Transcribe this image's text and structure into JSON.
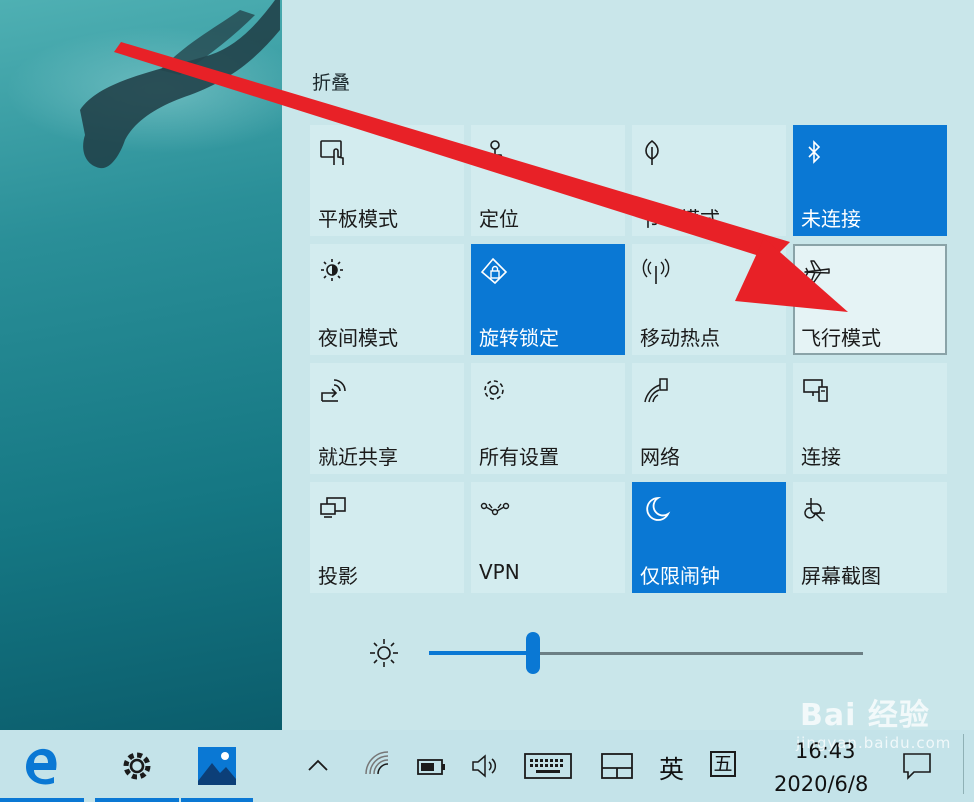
{
  "action_center": {
    "collapse_label": "折叠",
    "tiles": [
      {
        "label": "平板模式",
        "icon": "tablet-mode-icon",
        "state": "off"
      },
      {
        "label": "定位",
        "icon": "location-icon",
        "state": "off"
      },
      {
        "label": "节电模式",
        "icon": "battery-saver-icon",
        "state": "off"
      },
      {
        "label": "未连接",
        "icon": "bluetooth-icon",
        "state": "on"
      },
      {
        "label": "夜间模式",
        "icon": "night-light-icon",
        "state": "off"
      },
      {
        "label": "旋转锁定",
        "icon": "rotation-lock-icon",
        "state": "on"
      },
      {
        "label": "移动热点",
        "icon": "mobile-hotspot-icon",
        "state": "off"
      },
      {
        "label": "飞行模式",
        "icon": "airplane-icon",
        "state": "focused"
      },
      {
        "label": "就近共享",
        "icon": "nearby-share-icon",
        "state": "off"
      },
      {
        "label": "所有设置",
        "icon": "settings-gear-icon",
        "state": "off"
      },
      {
        "label": "网络",
        "icon": "network-icon",
        "state": "off"
      },
      {
        "label": "连接",
        "icon": "connect-icon",
        "state": "off"
      },
      {
        "label": "投影",
        "icon": "project-icon",
        "state": "off"
      },
      {
        "label": "VPN",
        "icon": "vpn-icon",
        "state": "off"
      },
      {
        "label": "仅限闹钟",
        "icon": "focus-assist-moon-icon",
        "state": "on"
      },
      {
        "label": "屏幕截图",
        "icon": "screen-snip-icon",
        "state": "off"
      }
    ],
    "brightness": {
      "icon": "brightness-icon",
      "level_fraction": 0.24
    }
  },
  "taskbar": {
    "apps": [
      {
        "name": "edge-browser-icon",
        "active": true
      },
      {
        "name": "settings-gear-icon",
        "active": true
      },
      {
        "name": "photos-app-icon",
        "active": true
      }
    ],
    "tray": {
      "show_hidden_icon": "chevron-up-icon",
      "wifi_icon": "wifi-icon",
      "battery_icon": "battery-icon",
      "volume_icon": "volume-icon",
      "keyboard_icon": "touch-keyboard-icon",
      "tablet_icon": "tablet-layout-icon",
      "ime_lang": "英",
      "ime_mode": "五",
      "time": "16:43",
      "date": "2020/6/8",
      "notification_icon": "notification-icon"
    }
  },
  "watermark": {
    "main": "Bai 经验",
    "sub": "jingyan.baidu.com"
  },
  "colors": {
    "accent": "#0a78d4",
    "panel": "#c9e6ea",
    "arrow": "#e82127"
  }
}
